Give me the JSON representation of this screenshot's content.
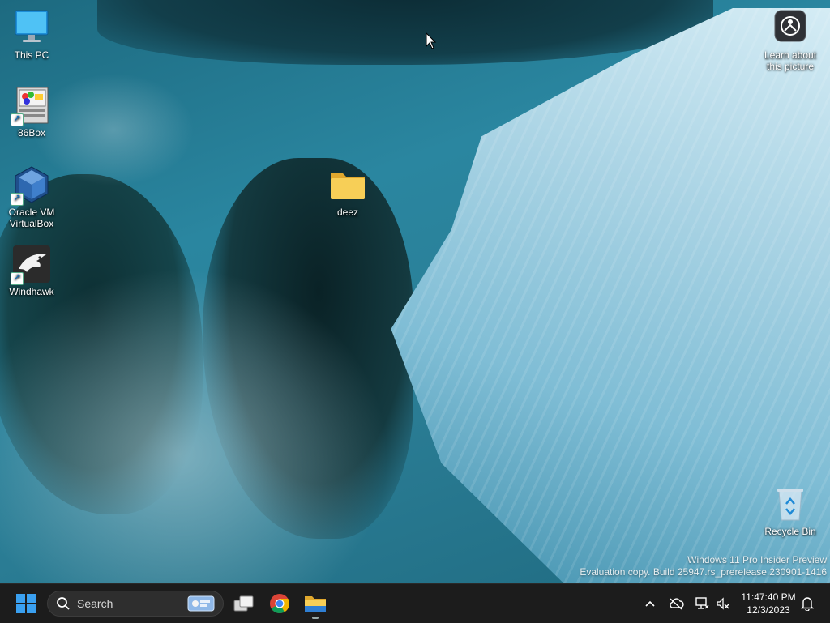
{
  "desktop": {
    "icons": [
      {
        "label": "This PC",
        "icon": "monitor-icon"
      },
      {
        "label": "86Box",
        "icon": "86box-app-icon"
      },
      {
        "label": "Oracle VM VirtualBox",
        "icon": "virtualbox-app-icon"
      },
      {
        "label": "Windhawk",
        "icon": "windhawk-app-icon"
      },
      {
        "label": "deez",
        "icon": "folder-icon"
      },
      {
        "label": "Learn about this picture",
        "icon": "learn-picture-icon"
      },
      {
        "label": "Recycle Bin",
        "icon": "recycle-bin-icon"
      }
    ]
  },
  "watermark": {
    "line1": "Windows 11 Pro Insider Preview",
    "line2": "Evaluation copy. Build 25947.rs_prerelease.230901-1416"
  },
  "taskbar": {
    "search_placeholder": "Search",
    "pinned": [
      {
        "name": "task-view",
        "icon": "task-view-icon"
      },
      {
        "name": "chrome",
        "icon": "chrome-icon"
      },
      {
        "name": "file-explorer",
        "icon": "file-explorer-icon"
      }
    ],
    "tray": {
      "time": "11:47:40 PM",
      "date": "12/3/2023"
    }
  },
  "colors": {
    "taskbar_bg": "#1c1c1c",
    "start_blue": "#3aa0f0",
    "folder_yellow": "#f4c542"
  }
}
